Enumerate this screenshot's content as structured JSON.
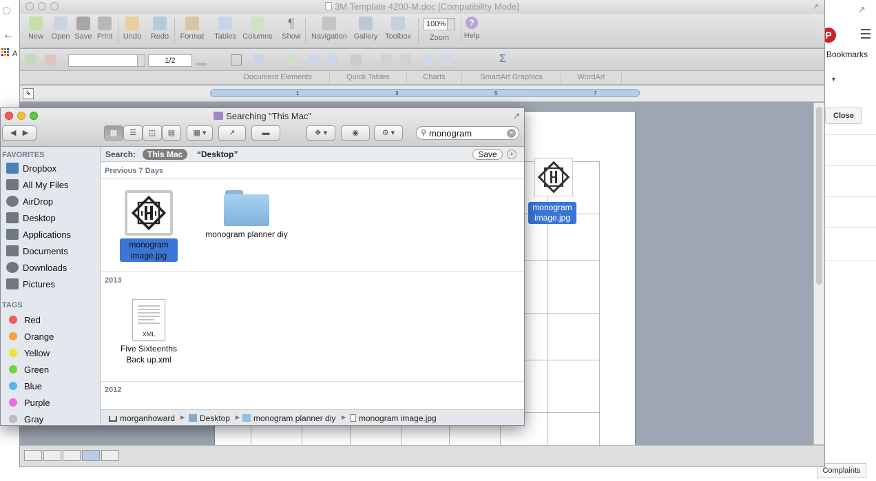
{
  "browser": {
    "bookmarks_label": "Bookmarks",
    "close_label": "Close",
    "complaints_label": "Complaints",
    "apps_letter": "A",
    "pinterest_letter": "P"
  },
  "word": {
    "title": "3M Template 4200-M.doc [Compatibility Mode]",
    "toolbar": [
      {
        "label": "New"
      },
      {
        "label": "Open"
      },
      {
        "label": "Save"
      },
      {
        "label": "Print"
      },
      {
        "label": "Undo"
      },
      {
        "label": "Redo"
      },
      {
        "label": "Format"
      },
      {
        "label": "Tables"
      },
      {
        "label": "Columns"
      },
      {
        "label": "Show"
      },
      {
        "label": "Navigation"
      },
      {
        "label": "Gallery"
      },
      {
        "label": "Toolbox"
      },
      {
        "label": "Zoom"
      },
      {
        "label": "Help"
      }
    ],
    "zoom_value": "100%",
    "page_indicator": "1/2",
    "ribbon_tabs": [
      "Document Elements",
      "Quick Tables",
      "Charts",
      "SmartArt Graphics",
      "WordArt"
    ],
    "ruler_ticks": [
      "1",
      "3",
      "5",
      "7"
    ],
    "desktop_file_label": "monogram image.jpg"
  },
  "finder": {
    "title": "Searching “This Mac”",
    "search_value": "monogram",
    "search_label": "Search:",
    "scope_active": "This Mac",
    "scope_other": "“Desktop”",
    "save_label": "Save",
    "sidebar": {
      "favorites_header": "FAVORITES",
      "favorites": [
        "Dropbox",
        "All My Files",
        "AirDrop",
        "Desktop",
        "Applications",
        "Documents",
        "Downloads",
        "Pictures"
      ],
      "tags_header": "TAGS",
      "tags": [
        {
          "name": "Red",
          "color": "#f25c5c"
        },
        {
          "name": "Orange",
          "color": "#f7a234"
        },
        {
          "name": "Yellow",
          "color": "#f2e232"
        },
        {
          "name": "Green",
          "color": "#72d43a"
        },
        {
          "name": "Blue",
          "color": "#52b6f2"
        },
        {
          "name": "Purple",
          "color": "#ec6ae8"
        },
        {
          "name": "Gray",
          "color": "#bdbdbd"
        }
      ]
    },
    "sections": [
      {
        "header": "Previous 7 Days",
        "items": [
          "monogram image.jpg",
          "monogram planner diy"
        ]
      },
      {
        "header": "2013",
        "items": [
          "Five Sixteenths Back up.xml"
        ]
      },
      {
        "header": "2012",
        "items": []
      }
    ],
    "xml_badge": "XML",
    "path": [
      "morganhoward",
      "Desktop",
      "monogram planner diy",
      "monogram image.jpg"
    ],
    "selection_color": "#3b75d6"
  }
}
